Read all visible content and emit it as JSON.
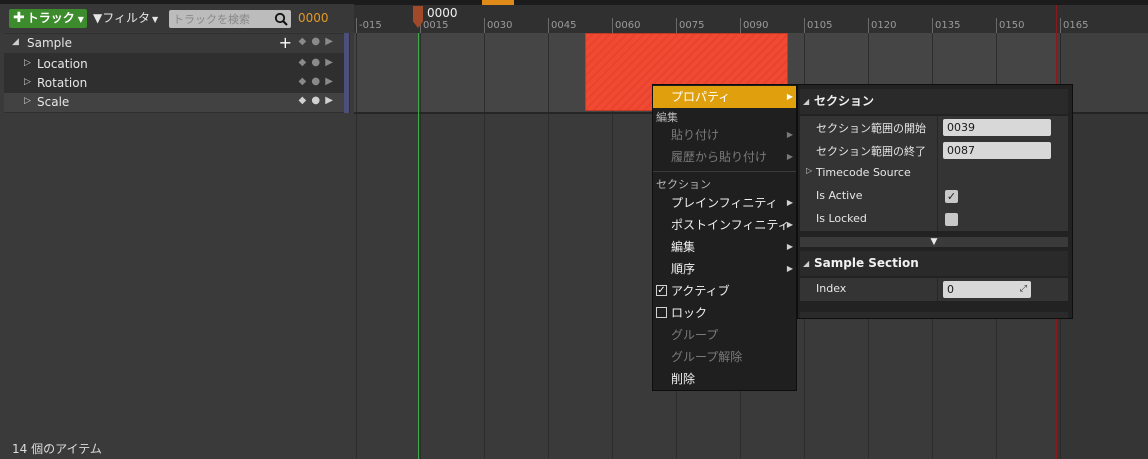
{
  "toolbar": {
    "add_track_label": "トラック",
    "filter_label": "フィルタ",
    "search_placeholder": "トラックを検索",
    "frame_counter": "0000"
  },
  "tracks": [
    {
      "label": "Sample"
    },
    {
      "label": "Location"
    },
    {
      "label": "Rotation"
    },
    {
      "label": "Scale"
    }
  ],
  "item_count": "14 個のアイテム",
  "timeline": {
    "playhead_label": "0000",
    "ticks": [
      "-015",
      "0015",
      "0030",
      "0045",
      "0060",
      "0075",
      "0090",
      "0105",
      "0120",
      "0135",
      "0150",
      "0165"
    ]
  },
  "context_menu": {
    "properties": "プロパティ",
    "header_edit": "編集",
    "paste": "貼り付け",
    "paste_history": "履歴から貼り付け",
    "header_section": "セクション",
    "pre_infinity": "プレインフィニティ",
    "post_infinity": "ポストインフィニティ",
    "edit": "編集",
    "order": "順序",
    "active": "アクティブ",
    "lock": "ロック",
    "group": "グループ",
    "ungroup": "グループ解除",
    "delete": "削除"
  },
  "details": {
    "section_title": "セクション",
    "start_label": "セクション範囲の開始",
    "start_value": "0039",
    "end_label": "セクション範囲の終了",
    "end_value": "0087",
    "timecode_label": "Timecode Source",
    "is_active_label": "Is Active",
    "is_locked_label": "Is Locked",
    "sample_section_title": "Sample Section",
    "index_label": "Index",
    "index_value": "0"
  },
  "colors": {
    "accent_orange": "#e0a00e",
    "add_track_green": "#3c8b2c",
    "section_red": "#f04a32",
    "playhead_green": "#3fa64a"
  }
}
